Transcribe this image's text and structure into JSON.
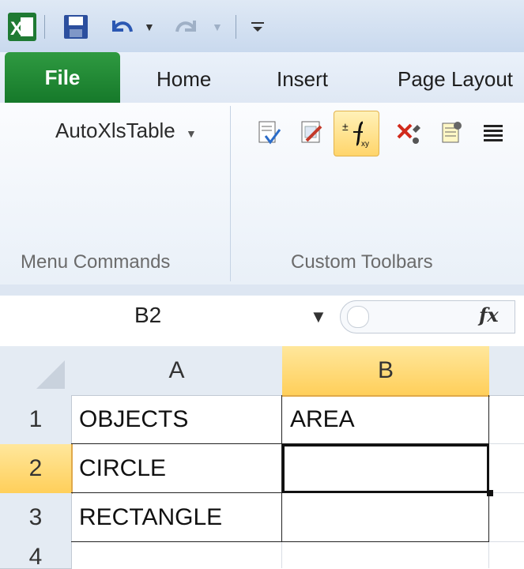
{
  "titlebar": {
    "icons": [
      "excel-icon",
      "save-icon",
      "undo-icon",
      "redo-icon",
      "customize-qat-icon"
    ]
  },
  "tabs": {
    "file": "File",
    "home": "Home",
    "insert": "Insert",
    "page_layout": "Page Layout"
  },
  "ribbon": {
    "autoxls": "AutoXlsTable",
    "group_menu": "Menu Commands",
    "group_toolbars": "Custom Toolbars",
    "toolbar_icons": [
      "check-doc-icon",
      "edit-sheet-icon",
      "formula-xy-icon",
      "remove-icon",
      "settings-doc-icon",
      "list-icon"
    ]
  },
  "formula_bar": {
    "name_box": "B2",
    "fx": "fx",
    "formula": ""
  },
  "sheet": {
    "columns": [
      "A",
      "B"
    ],
    "rows": [
      "1",
      "2",
      "3",
      "4"
    ],
    "cells": {
      "A1": "OBJECTS",
      "B1": "AREA",
      "A2": "CIRCLE",
      "B2": "",
      "A3": "RECTANGLE",
      "B3": ""
    },
    "selected_cell": "B2"
  },
  "colors": {
    "file_tab": "#1f8a35",
    "selection_header": "#ffd56b",
    "ribbon_bg": "#e9f0f8"
  }
}
